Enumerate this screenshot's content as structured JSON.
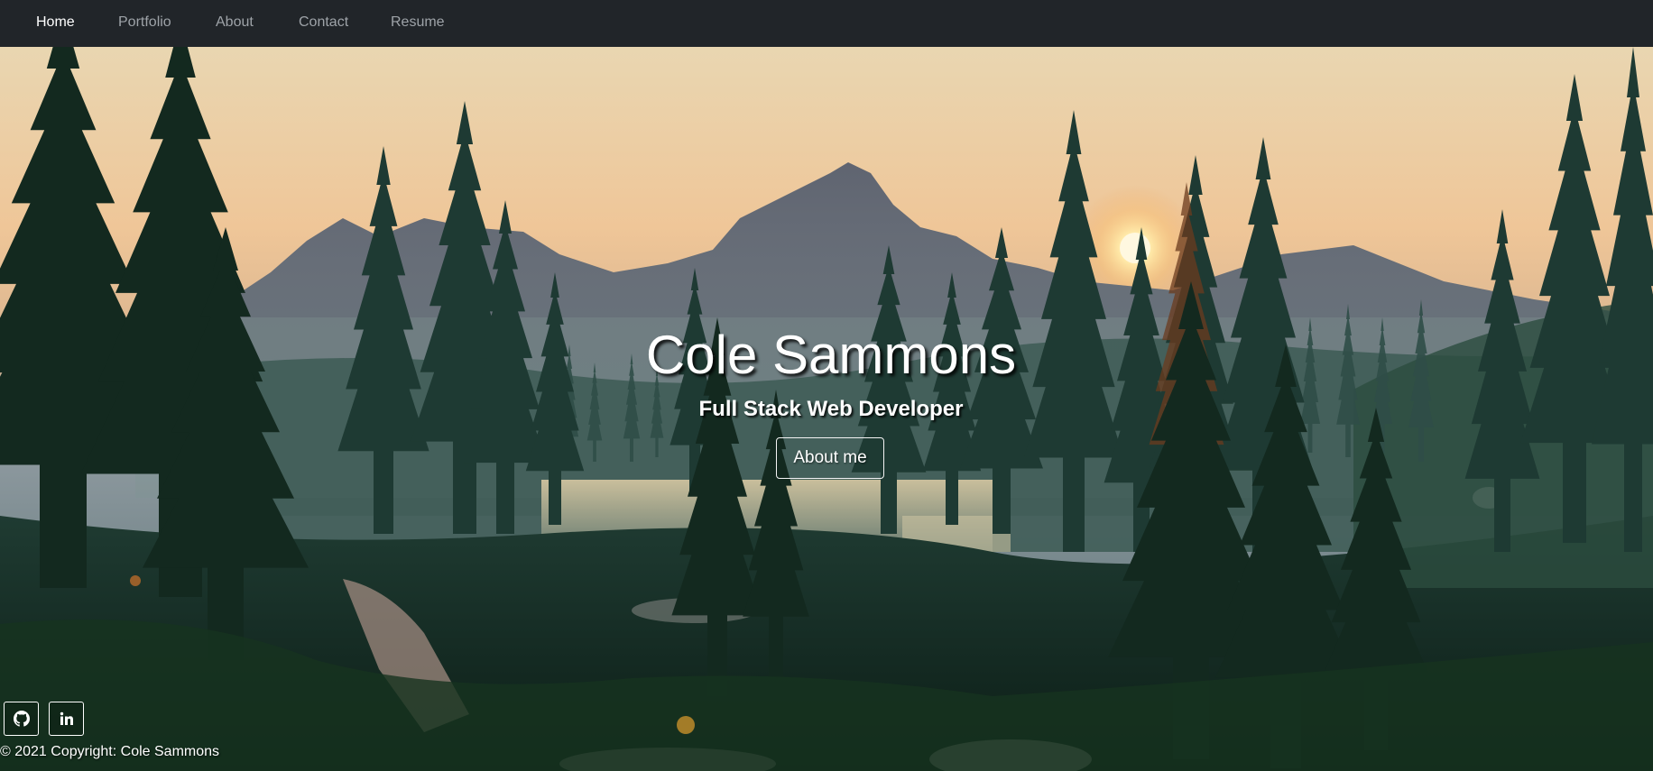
{
  "nav": {
    "items": [
      {
        "label": "Home",
        "active": true
      },
      {
        "label": "Portfolio",
        "active": false
      },
      {
        "label": "About",
        "active": false
      },
      {
        "label": "Contact",
        "active": false
      },
      {
        "label": "Resume",
        "active": false
      }
    ]
  },
  "hero": {
    "name": "Cole Sammons",
    "subtitle": "Full Stack Web Developer",
    "cta_label": "About me",
    "background": "forest-mountain-sunset-photo"
  },
  "footer": {
    "social": [
      {
        "icon": "github-icon"
      },
      {
        "icon": "linkedin-icon"
      }
    ],
    "copyright": "© 2021 Copyright: Cole Sammons"
  },
  "colors": {
    "navbar_bg": "#212529",
    "nav_text": "#9ea3a8",
    "nav_active": "#ffffff",
    "hero_text": "#ffffff"
  }
}
